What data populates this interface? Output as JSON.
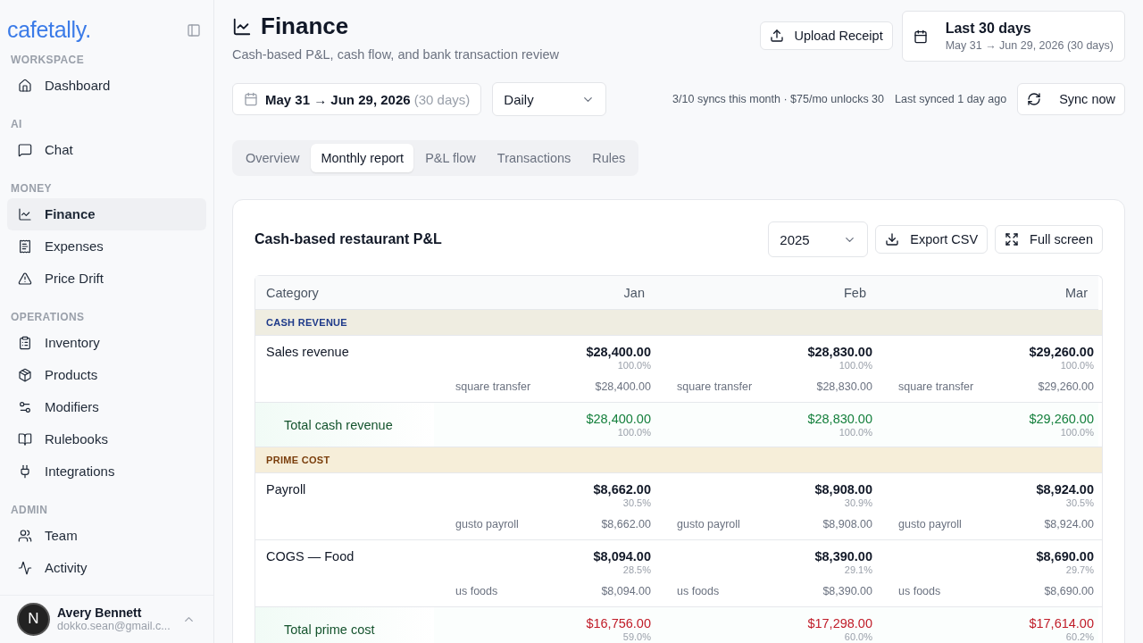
{
  "sidebar": {
    "logo": "cafetally.",
    "groups": [
      {
        "label": "WORKSPACE",
        "items": [
          {
            "label": "Dashboard",
            "selected": false
          }
        ]
      },
      {
        "label": "AI",
        "items": [
          {
            "label": "Chat",
            "selected": false
          }
        ]
      },
      {
        "label": "MONEY",
        "items": [
          {
            "label": "Finance",
            "selected": true
          },
          {
            "label": "Expenses",
            "selected": false
          },
          {
            "label": "Price Drift",
            "selected": false
          }
        ]
      },
      {
        "label": "OPERATIONS",
        "items": [
          {
            "label": "Inventory",
            "selected": false
          },
          {
            "label": "Products",
            "selected": false
          },
          {
            "label": "Modifiers",
            "selected": false
          },
          {
            "label": "Rulebooks",
            "selected": false
          },
          {
            "label": "Integrations",
            "selected": false
          }
        ]
      },
      {
        "label": "ADMIN",
        "items": [
          {
            "label": "Team",
            "selected": false
          },
          {
            "label": "Activity",
            "selected": false
          }
        ]
      }
    ],
    "user": {
      "initial": "N",
      "name": "Avery Bennett",
      "email": "dokko.sean@gmail.c..."
    }
  },
  "header": {
    "title": "Finance",
    "subtitle": "Cash-based P&L, cash flow, and bank transaction review",
    "upload_button": "Upload Receipt",
    "range": {
      "title": "Last 30 days",
      "dates": "May 31 → Jun 29, 2026 (30 days)"
    }
  },
  "filters": {
    "date_field": {
      "value": "May 31 → Jun 29, 2026",
      "note": "(30 days)"
    },
    "granularity": "Daily",
    "sync_quota": "3/10 syncs this month · $75/mo unlocks 30",
    "last_synced": "Last synced 1 day ago",
    "sync_button": "Sync now"
  },
  "tabs": [
    {
      "label": "Overview",
      "selected": false
    },
    {
      "label": "Monthly report",
      "selected": true
    },
    {
      "label": "P&L flow",
      "selected": false
    },
    {
      "label": "Transactions",
      "selected": false
    },
    {
      "label": "Rules",
      "selected": false
    }
  ],
  "report": {
    "title": "Cash-based restaurant P&L",
    "year": "2025",
    "export_button": "Export CSV",
    "fullscreen_button": "Full screen",
    "columns": [
      "Category",
      "Jan",
      "Feb",
      "Mar"
    ],
    "rows": [
      {
        "kind": "section",
        "color": "#1e3a8a",
        "label": "CASH REVENUE"
      },
      {
        "kind": "line",
        "label": "Sales revenue",
        "cells": [
          {
            "amount": "$28,400.00",
            "share": "100.0%",
            "source": "square transfer",
            "source_amount": "$28,400.00"
          },
          {
            "amount": "$28,830.00",
            "share": "100.0%",
            "source": "square transfer",
            "source_amount": "$28,830.00"
          },
          {
            "amount": "$29,260.00",
            "share": "100.0%",
            "source": "square transfer",
            "source_amount": "$29,260.00"
          }
        ]
      },
      {
        "kind": "total",
        "color": "#15803d",
        "label": "Total cash revenue",
        "cells": [
          {
            "amount": "$28,400.00",
            "share": "100.0%"
          },
          {
            "amount": "$28,830.00",
            "share": "100.0%"
          },
          {
            "amount": "$29,260.00",
            "share": "100.0%"
          }
        ]
      },
      {
        "kind": "section",
        "color": "#7a3e0c",
        "label": "PRIME COST"
      },
      {
        "kind": "line",
        "label": "Payroll",
        "cells": [
          {
            "amount": "$8,662.00",
            "share": "30.5%",
            "source": "gusto payroll",
            "source_amount": "$8,662.00"
          },
          {
            "amount": "$8,908.00",
            "share": "30.9%",
            "source": "gusto payroll",
            "source_amount": "$8,908.00"
          },
          {
            "amount": "$8,924.00",
            "share": "30.5%",
            "source": "gusto payroll",
            "source_amount": "$8,924.00"
          }
        ]
      },
      {
        "kind": "line",
        "label": "COGS — Food",
        "cells": [
          {
            "amount": "$8,094.00",
            "share": "28.5%",
            "source": "us foods",
            "source_amount": "$8,094.00"
          },
          {
            "amount": "$8,390.00",
            "share": "29.1%",
            "source": "us foods",
            "source_amount": "$8,390.00"
          },
          {
            "amount": "$8,690.00",
            "share": "29.7%",
            "source": "us foods",
            "source_amount": "$8,690.00"
          }
        ]
      },
      {
        "kind": "total",
        "color": "#c01c28",
        "label": "Total prime cost",
        "cells": [
          {
            "amount": "$16,756.00",
            "share": "59.0%"
          },
          {
            "amount": "$17,298.00",
            "share": "60.0%"
          },
          {
            "amount": "$17,614.00",
            "share": "60.2%"
          }
        ]
      }
    ]
  }
}
